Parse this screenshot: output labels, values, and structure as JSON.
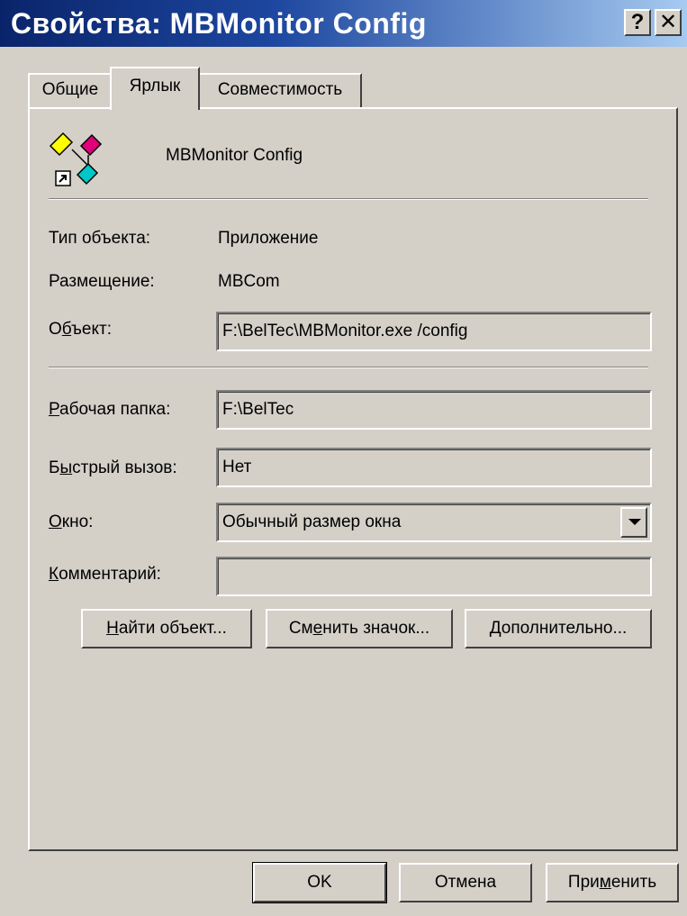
{
  "window": {
    "title": "Свойства: MBMonitor Config",
    "help_glyph": "?",
    "close_glyph": "✕"
  },
  "tabs": [
    {
      "label": "Общие",
      "active": false
    },
    {
      "label": "Ярлык",
      "active": true
    },
    {
      "label": "Совместимость",
      "active": false
    }
  ],
  "shortcut": {
    "icon": "shortcut-app-icon",
    "name": "MBMonitor Config",
    "target_type_label": "Тип объекта:",
    "target_type_value": "Приложение",
    "location_label": "Размещение:",
    "location_value": "MBCom",
    "target_label_pre": "О",
    "target_label_ul": "б",
    "target_label_post": "ъект:",
    "target_value": "F:\\BelTec\\MBMonitor.exe /config",
    "startin_label_ul": "Р",
    "startin_label_post": "абочая папка:",
    "startin_value": "F:\\BelTec",
    "hotkey_label_pre": "Б",
    "hotkey_label_ul": "ы",
    "hotkey_label_post": "стрый вызов:",
    "hotkey_value": "Нет",
    "run_label_ul": "О",
    "run_label_post": "кно:",
    "run_value": "Обычный размер окна",
    "comment_label_ul": "К",
    "comment_label_post": "омментарий:",
    "comment_value": ""
  },
  "buttons": {
    "find_ul": "Н",
    "find_post": "айти объект...",
    "change_pre": "См",
    "change_ul": "е",
    "change_post": "нить значок...",
    "advanced_ul": "Д",
    "advanced_post": "ополнительно...",
    "ok": "OK",
    "cancel": "Отмена",
    "apply_pre": "При",
    "apply_ul": "м",
    "apply_post": "енить"
  },
  "colors": {
    "titlebar_start": "#0a246a",
    "titlebar_end": "#a6caf0",
    "face": "#d4d0c8"
  }
}
